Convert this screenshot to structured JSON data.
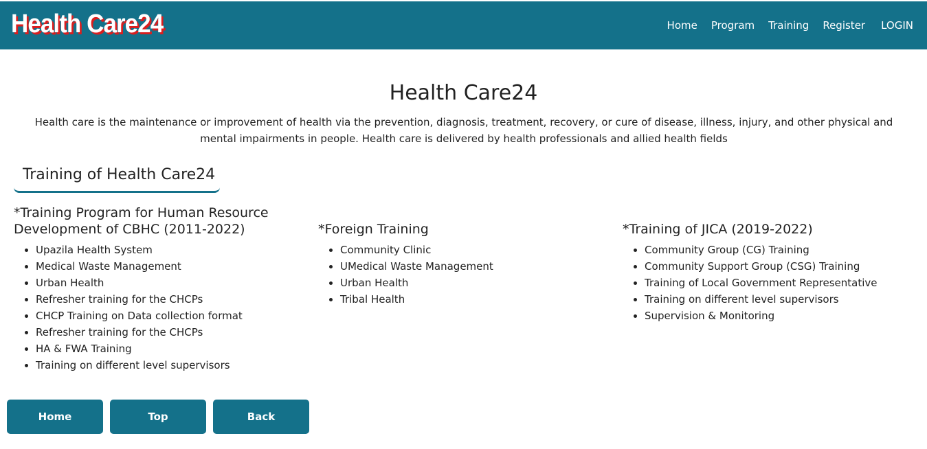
{
  "header": {
    "logo": "Health Care24",
    "nav": [
      "Home",
      "Program",
      "Training",
      "Register",
      "LOGIN"
    ]
  },
  "main": {
    "title": "Health Care24",
    "intro": "Health care is the maintenance or improvement of health via the prevention, diagnosis, treatment, recovery, or cure of disease, illness, injury, and other physical and mental impairments in people. Health care is delivered by health professionals and allied health fields",
    "section_heading": "Training of Health Care24",
    "columns": [
      {
        "heading": "*Training Program for Human Resource Development of CBHC (2011-2022)",
        "items": [
          "Upazila Health System",
          "Medical Waste Management",
          "Urban Health",
          "Refresher training for the CHCPs",
          "CHCP Training on Data collection format",
          "Refresher training for the CHCPs",
          "HA & FWA Training",
          "Training on different level supervisors"
        ]
      },
      {
        "heading": "*Foreign Training",
        "items": [
          "Community Clinic",
          "UMedical Waste Management",
          "Urban Health",
          "Tribal Health"
        ]
      },
      {
        "heading": "*Training of JICA (2019-2022)",
        "items": [
          "Community Group (CG) Training",
          "Community Support Group (CSG) Training",
          "Training of Local Government Representative",
          "Training on different level supervisors",
          "Supervision & Monitoring"
        ]
      }
    ]
  },
  "footer_buttons": [
    "Home",
    "Top",
    "Back"
  ],
  "colors": {
    "primary": "#14718a",
    "logo_shadow": "#d91f1f"
  }
}
